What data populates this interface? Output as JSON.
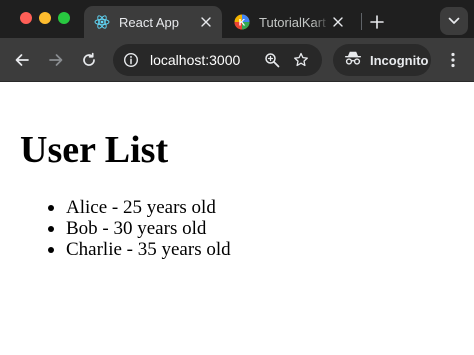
{
  "browser": {
    "tabs": [
      {
        "title": "React App",
        "active": true,
        "favicon": "react-logo-icon"
      },
      {
        "title": "TutorialKart -",
        "active": false,
        "favicon": "tutorialkart-logo-icon"
      }
    ],
    "address_bar": {
      "url": "localhost:3000"
    },
    "incognito_label": "Incognito"
  },
  "page": {
    "title": "User List",
    "users": [
      {
        "text": "Alice - 25 years old"
      },
      {
        "text": "Bob - 30 years old"
      },
      {
        "text": "Charlie - 35 years old"
      }
    ]
  },
  "colors": {
    "tabstrip_bg": "#1f1f1f",
    "toolbar_bg": "#3c3c3c",
    "omnibox_bg": "#282828",
    "page_bg": "#ffffff",
    "react_logo": "#61dafb"
  }
}
